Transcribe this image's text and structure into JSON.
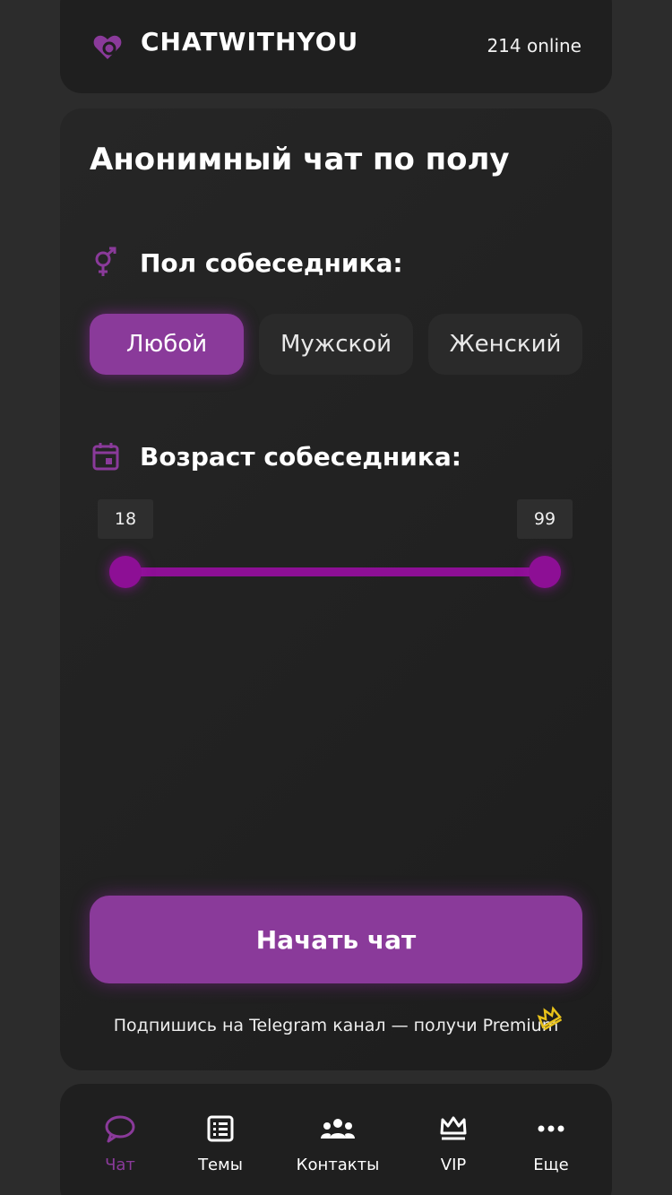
{
  "header": {
    "app_name": "CHATWITHYOU",
    "online": "214 online"
  },
  "card": {
    "title": "Анонимный чат по полу",
    "gender_label": "Пол собеседника:",
    "gender_options": [
      "Любой",
      "Мужской",
      "Женский"
    ],
    "gender_selected": "Любой",
    "age_label": "Возраст собеседника:",
    "age_min": "18",
    "age_max": "99",
    "start_button": "Начать чат",
    "promo": "Подпишись на Telegram канал — получи Premium"
  },
  "nav": {
    "items": [
      {
        "label": "Чат",
        "icon": "chat-bubble-icon",
        "active": true
      },
      {
        "label": "Темы",
        "icon": "list-icon",
        "active": false
      },
      {
        "label": "Контакты",
        "icon": "users-icon",
        "active": false
      },
      {
        "label": "VIP",
        "icon": "crown-icon",
        "active": false
      },
      {
        "label": "Еще",
        "icon": "more-dots-icon",
        "active": false
      }
    ]
  },
  "colors": {
    "accent": "#8a3a9a",
    "slider": "#8d0f95",
    "card_bg": "#1f1f1f",
    "page_bg": "#2c2c2c",
    "crown": "#e8c21a"
  }
}
